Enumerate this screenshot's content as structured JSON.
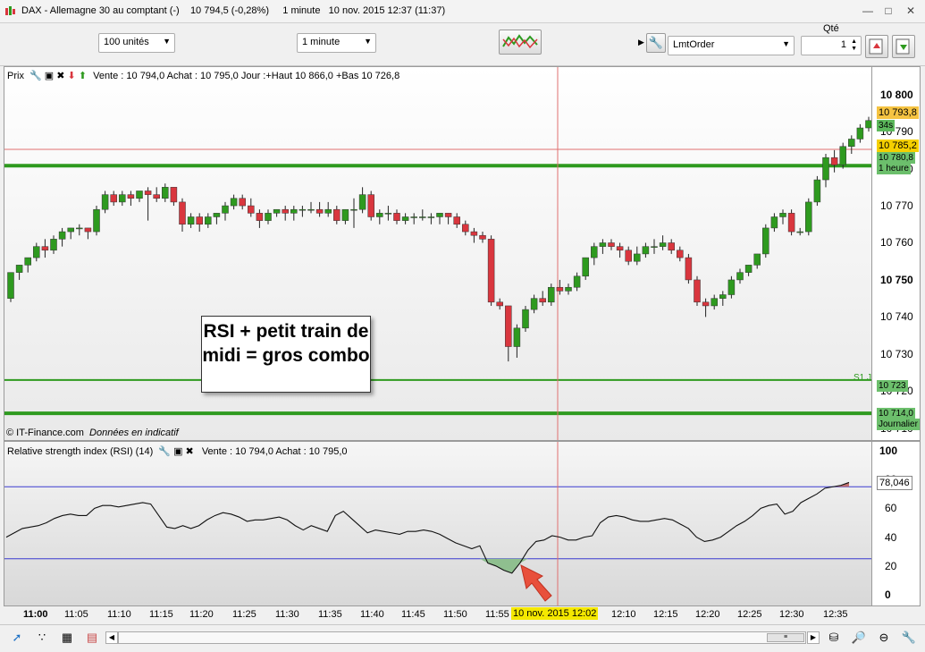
{
  "window": {
    "title": "DAX - Allemagne 30 au comptant (-)",
    "price": "10 794,5 (-0,28%)",
    "interval": "1 minute",
    "datetime": "10 nov. 2015 12:37 (11:37)"
  },
  "toolbar": {
    "units_value": "100 unités",
    "timeframe_value": "1 minute",
    "order_type": "LmtOrder",
    "qty_label": "Qté",
    "qty_value": "1"
  },
  "price_pane": {
    "label": "Prix",
    "info": "Vente : 10 794,0  Achat : 10 795,0  Jour :+Haut 10 866,0  +Bas 10 726,8",
    "footer": "© IT-Finance.com",
    "footer_italic": "Données en indicatif",
    "s1_label": "S1 J",
    "annotation": "RSI + petit train de midi = gros combo",
    "markers": [
      {
        "value": "10 793,8",
        "bg": "#f5c342"
      },
      {
        "value": "34s",
        "bg": "#5cb85c"
      },
      {
        "value": "10 785,2",
        "bg": "#f5d000"
      },
      {
        "value": "10 780,8",
        "bg": "#6cbf6c"
      },
      {
        "value": "1 heure",
        "bg": "#6cbf6c"
      },
      {
        "value": "10 723",
        "bg": "#6cbf6c"
      },
      {
        "value": "10 714,0",
        "bg": "#6cbf6c"
      },
      {
        "value": "Journalier",
        "bg": "#6cbf6c"
      }
    ],
    "y_ticks": [
      "10 800",
      "10 790",
      "10 780",
      "10 770",
      "10 760",
      "10 750",
      "10 740",
      "10 730",
      "10 720",
      "10 710"
    ]
  },
  "rsi_pane": {
    "label": "Relative strength index (RSI) (14)",
    "info": "Vente : 10 794,0  Achat : 10 795,0",
    "current": "78,046",
    "y_ticks": [
      "100",
      "80",
      "60",
      "40",
      "20",
      "0"
    ]
  },
  "time_axis": {
    "labels": [
      "11:00",
      "11:05",
      "11:10",
      "11:15",
      "11:20",
      "11:25",
      "11:30",
      "11:35",
      "11:40",
      "11:45",
      "11:50",
      "11:55",
      "12:02",
      "12:10",
      "12:15",
      "12:20",
      "12:25",
      "12:30",
      "12:35"
    ],
    "cursor_label": "10 nov. 2015 12:02"
  },
  "chart_data": [
    {
      "type": "candlestick",
      "ylim": [
        10708,
        10805
      ],
      "levels": [
        {
          "value": 10780.8,
          "color": "#2e9a1f"
        },
        {
          "value": 10723,
          "color": "#2e9a1f"
        },
        {
          "value": 10714,
          "color": "#2e9a1f"
        },
        {
          "value": 10785.2,
          "color": "#e07070"
        }
      ],
      "candles": [
        [
          10745,
          10752,
          10744,
          10752
        ],
        [
          10752,
          10754,
          10750,
          10754
        ],
        [
          10754,
          10756,
          10752,
          10756
        ],
        [
          10756,
          10760,
          10755,
          10759
        ],
        [
          10759,
          10761,
          10756,
          10758
        ],
        [
          10758,
          10762,
          10757,
          10761
        ],
        [
          10761,
          10764,
          10759,
          10763
        ],
        [
          10763,
          10764,
          10761,
          10764
        ],
        [
          10764,
          10765,
          10762,
          10764
        ],
        [
          10764,
          10764,
          10761,
          10763
        ],
        [
          10763,
          10770,
          10762,
          10769
        ],
        [
          10769,
          10774,
          10768,
          10773
        ],
        [
          10773,
          10774,
          10770,
          10771
        ],
        [
          10771,
          10774,
          10770,
          10773
        ],
        [
          10773,
          10774,
          10770,
          10772
        ],
        [
          10772,
          10774,
          10771,
          10774
        ],
        [
          10774,
          10775,
          10766,
          10773
        ],
        [
          10773,
          10775,
          10771,
          10772
        ],
        [
          10772,
          10776,
          10771,
          10775
        ],
        [
          10775,
          10775,
          10770,
          10771
        ],
        [
          10771,
          10772,
          10763,
          10765
        ],
        [
          10765,
          10768,
          10764,
          10767
        ],
        [
          10767,
          10768,
          10763,
          10765
        ],
        [
          10765,
          10768,
          10764,
          10767
        ],
        [
          10767,
          10768,
          10765,
          10768
        ],
        [
          10768,
          10771,
          10766,
          10770
        ],
        [
          10770,
          10773,
          10769,
          10772
        ],
        [
          10772,
          10773,
          10769,
          10770
        ],
        [
          10770,
          10772,
          10767,
          10768
        ],
        [
          10768,
          10769,
          10764,
          10766
        ],
        [
          10766,
          10769,
          10765,
          10768
        ],
        [
          10768,
          10769,
          10767,
          10769
        ],
        [
          10769,
          10770,
          10766,
          10768
        ],
        [
          10768,
          10770,
          10766,
          10769
        ],
        [
          10769,
          10770,
          10767,
          10769
        ],
        [
          10769,
          10771,
          10768,
          10769
        ],
        [
          10769,
          10771,
          10767,
          10768
        ],
        [
          10768,
          10771,
          10767,
          10769
        ],
        [
          10769,
          10770,
          10765,
          10766
        ],
        [
          10766,
          10769,
          10765,
          10769
        ],
        [
          10769,
          10772,
          10764,
          10769
        ],
        [
          10769,
          10775,
          10768,
          10773
        ],
        [
          10773,
          10774,
          10766,
          10767
        ],
        [
          10767,
          10769,
          10765,
          10768
        ],
        [
          10768,
          10770,
          10766,
          10768
        ],
        [
          10768,
          10769,
          10765,
          10766
        ],
        [
          10766,
          10768,
          10765,
          10767
        ],
        [
          10767,
          10768,
          10765,
          10767
        ],
        [
          10767,
          10769,
          10766,
          10767
        ],
        [
          10767,
          10768,
          10765,
          10767
        ],
        [
          10767,
          10768,
          10765,
          10768
        ],
        [
          10768,
          10768,
          10765,
          10767
        ],
        [
          10767,
          10768,
          10764,
          10765
        ],
        [
          10765,
          10766,
          10762,
          10763
        ],
        [
          10763,
          10764,
          10760,
          10762
        ],
        [
          10762,
          10763,
          10760,
          10761
        ],
        [
          10761,
          10762,
          10743,
          10744
        ],
        [
          10744,
          10745,
          10742,
          10743
        ],
        [
          10743,
          10743,
          10728,
          10732
        ],
        [
          10732,
          10738,
          10729,
          10737
        ],
        [
          10737,
          10743,
          10736,
          10742
        ],
        [
          10742,
          10746,
          10741,
          10745
        ],
        [
          10745,
          10747,
          10743,
          10744
        ],
        [
          10744,
          10749,
          10743,
          10748
        ],
        [
          10748,
          10750,
          10746,
          10747
        ],
        [
          10747,
          10749,
          10746,
          10748
        ],
        [
          10748,
          10752,
          10747,
          10751
        ],
        [
          10751,
          10756,
          10750,
          10756
        ],
        [
          10756,
          10760,
          10754,
          10759
        ],
        [
          10759,
          10761,
          10757,
          10760
        ],
        [
          10760,
          10761,
          10758,
          10759
        ],
        [
          10759,
          10760,
          10756,
          10758
        ],
        [
          10758,
          10759,
          10754,
          10755
        ],
        [
          10755,
          10759,
          10754,
          10757
        ],
        [
          10757,
          10760,
          10756,
          10759
        ],
        [
          10759,
          10761,
          10757,
          10759
        ],
        [
          10759,
          10762,
          10758,
          10760
        ],
        [
          10760,
          10761,
          10757,
          10758
        ],
        [
          10758,
          10759,
          10755,
          10756
        ],
        [
          10756,
          10757,
          10749,
          10750
        ],
        [
          10750,
          10751,
          10743,
          10744
        ],
        [
          10744,
          10745,
          10740,
          10743
        ],
        [
          10743,
          10746,
          10742,
          10745
        ],
        [
          10745,
          10747,
          10743,
          10746
        ],
        [
          10746,
          10751,
          10745,
          10750
        ],
        [
          10750,
          10753,
          10749,
          10752
        ],
        [
          10752,
          10754,
          10751,
          10754
        ],
        [
          10754,
          10757,
          10753,
          10757
        ],
        [
          10757,
          10765,
          10756,
          10764
        ],
        [
          10764,
          10768,
          10763,
          10767
        ],
        [
          10767,
          10769,
          10765,
          10768
        ],
        [
          10768,
          10769,
          10762,
          10763
        ],
        [
          10763,
          10764,
          10762,
          10763
        ],
        [
          10763,
          10772,
          10762,
          10771
        ],
        [
          10771,
          10778,
          10770,
          10777
        ],
        [
          10777,
          10784,
          10775,
          10783
        ],
        [
          10783,
          10785,
          10779,
          10781
        ],
        [
          10781,
          10787,
          10780,
          10786
        ],
        [
          10786,
          10789,
          10784,
          10788
        ],
        [
          10788,
          10792,
          10787,
          10791
        ],
        [
          10791,
          10794,
          10790,
          10793
        ]
      ]
    },
    {
      "type": "line",
      "ylim": [
        0,
        100
      ],
      "levels": [
        75,
        25
      ],
      "values": [
        40,
        43,
        46,
        47,
        48,
        50,
        53,
        55,
        56,
        55,
        55,
        60,
        62,
        62,
        61,
        62,
        63,
        64,
        63,
        55,
        47,
        46,
        48,
        46,
        48,
        52,
        55,
        57,
        56,
        54,
        51,
        52,
        52,
        53,
        54,
        52,
        48,
        45,
        48,
        46,
        44,
        55,
        58,
        53,
        48,
        43,
        45,
        44,
        43,
        42,
        44,
        44,
        45,
        44,
        42,
        39,
        36,
        34,
        32,
        34,
        22,
        20,
        17,
        15,
        22,
        31,
        37,
        38,
        41,
        40,
        38,
        38,
        40,
        41,
        50,
        54,
        55,
        54,
        52,
        51,
        51,
        52,
        53,
        52,
        49,
        46,
        40,
        37,
        38,
        40,
        44,
        48,
        51,
        55,
        60,
        62,
        63,
        56,
        58,
        64,
        67,
        70,
        74,
        75,
        76,
        78
      ]
    }
  ],
  "status_icons": [
    "arrow-tool",
    "magnet-tool",
    "grid-tool",
    "layers-tool",
    "zoom-fit",
    "zoom-in",
    "zoom-out",
    "settings-tool"
  ]
}
